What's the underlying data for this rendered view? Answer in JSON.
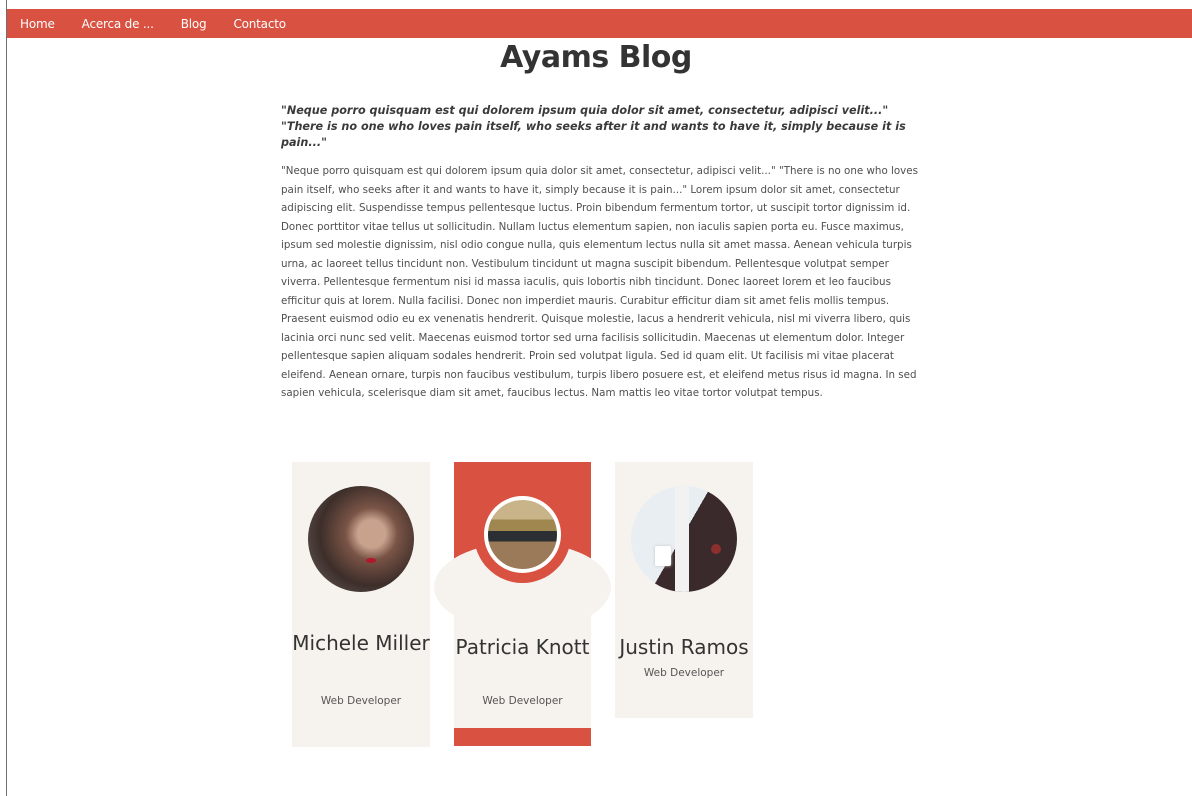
{
  "nav": {
    "items": [
      "Home",
      "Acerca de ...",
      "Blog",
      "Contacto"
    ]
  },
  "page": {
    "title": "Ayams Blog",
    "quote": "\"Neque porro quisquam est qui dolorem ipsum quia dolor sit amet, consectetur, adipisci velit...\" \"There is no one who loves pain itself, who seeks after it and wants to have it, simply because it is pain...\"",
    "body": "\"Neque porro quisquam est qui dolorem ipsum quia dolor sit amet, consectetur, adipisci velit...\" \"There is no one who loves pain itself, who seeks after it and wants to have it, simply because it is pain...\" Lorem ipsum dolor sit amet, consectetur adipiscing elit. Suspendisse tempus pellentesque luctus. Proin bibendum fermentum tortor, ut suscipit tortor dignissim id. Donec porttitor vitae tellus ut sollicitudin. Nullam luctus elementum sapien, non iaculis sapien porta eu. Fusce maximus, ipsum sed molestie dignissim, nisl odio congue nulla, quis elementum lectus nulla sit amet massa. Aenean vehicula turpis urna, ac laoreet tellus tincidunt non. Vestibulum tincidunt ut magna suscipit bibendum. Pellentesque volutpat semper viverra. Pellentesque fermentum nisi id massa iaculis, quis lobortis nibh tincidunt. Donec laoreet lorem et leo faucibus efficitur quis at lorem. Nulla facilisi. Donec non imperdiet mauris. Curabitur efficitur diam sit amet felis mollis tempus. Praesent euismod odio eu ex venenatis hendrerit. Quisque molestie, lacus a hendrerit vehicula, nisl mi viverra libero, quis lacinia orci nunc sed velit. Maecenas euismod tortor sed urna facilisis sollicitudin. Maecenas ut elementum dolor. Integer pellentesque sapien aliquam sodales hendrerit. Proin sed volutpat ligula. Sed id quam elit. Ut facilisis mi vitae placerat eleifend. Aenean ornare, turpis non faucibus vestibulum, turpis libero posuere est, et eleifend metus risus id magna. In sed sapien vehicula, scelerisque diam sit amet, faucibus lectus. Nam mattis leo vitae tortor volutpat tempus."
  },
  "team": [
    {
      "name": "Michele Miller",
      "role": "Web Developer"
    },
    {
      "name": "Patricia Knott",
      "role": "Web Developer"
    },
    {
      "name": "Justin Ramos",
      "role": "Web Developer"
    }
  ],
  "colors": {
    "accent": "#d95141",
    "card_bg": "#f6f3ee",
    "text": "#333333"
  }
}
